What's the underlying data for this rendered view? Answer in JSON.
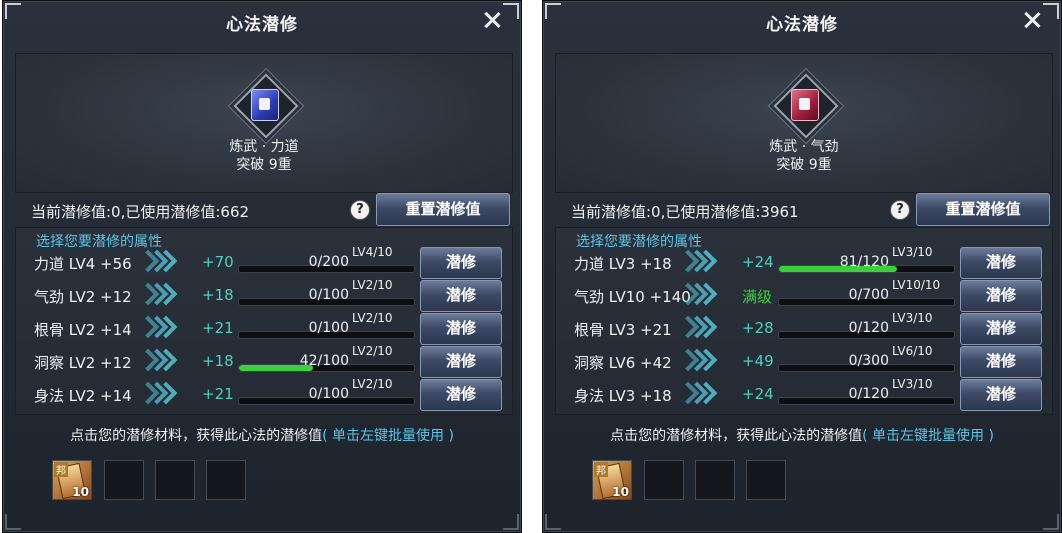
{
  "panels": [
    {
      "title": "心法潜修",
      "book_name": "炼武 · 力道",
      "book_break": "突破 9重",
      "status": "当前潜修值:0,已使用潜修值:662",
      "help_glyph": "?",
      "reset_label": "重置潜修值",
      "list_label": "选择您要潜修的属性",
      "rows": [
        {
          "attr": "力道 LV4 +56",
          "bonus": "+70",
          "progress": "0/200",
          "fill": 0.0,
          "lv": "LV4/10",
          "button": "潜修"
        },
        {
          "attr": "气劲 LV2 +12",
          "bonus": "+18",
          "progress": "0/100",
          "fill": 0.0,
          "lv": "LV2/10",
          "button": "潜修"
        },
        {
          "attr": "根骨 LV2 +14",
          "bonus": "+21",
          "progress": "0/100",
          "fill": 0.0,
          "lv": "LV2/10",
          "button": "潜修"
        },
        {
          "attr": "洞察 LV2 +12",
          "bonus": "+18",
          "progress": "42/100",
          "fill": 0.42,
          "lv": "LV2/10",
          "button": "潜修"
        },
        {
          "attr": "身法 LV2 +14",
          "bonus": "+21",
          "progress": "0/100",
          "fill": 0.0,
          "lv": "LV2/10",
          "button": "潜修"
        }
      ],
      "hint_text": "点击您的潜修材料，获得此心法的潜修值",
      "hint_link": "( 单击左键批量使用 )",
      "item_tag": "邦",
      "item_count": "10"
    },
    {
      "title": "心法潜修",
      "book_name": "炼武 · 气劲",
      "book_break": "突破 9重",
      "status": "当前潜修值:0,已使用潜修值:3961",
      "help_glyph": "?",
      "reset_label": "重置潜修值",
      "list_label": "选择您要潜修的属性",
      "rows": [
        {
          "attr": "力道 LV3 +18",
          "bonus": "+24",
          "progress": "81/120",
          "fill": 0.675,
          "lv": "LV3/10",
          "button": "潜修"
        },
        {
          "attr": "气劲 LV10 +140",
          "bonus": "满级",
          "progress": "0/700",
          "fill": 0.0,
          "lv": "LV10/10",
          "button": "潜修"
        },
        {
          "attr": "根骨 LV3 +21",
          "bonus": "+28",
          "progress": "0/120",
          "fill": 0.0,
          "lv": "LV3/10",
          "button": "潜修"
        },
        {
          "attr": "洞察 LV6 +42",
          "bonus": "+49",
          "progress": "0/300",
          "fill": 0.0,
          "lv": "LV6/10",
          "button": "潜修"
        },
        {
          "attr": "身法 LV3 +18",
          "bonus": "+24",
          "progress": "0/120",
          "fill": 0.0,
          "lv": "LV3/10",
          "button": "潜修"
        }
      ],
      "hint_text": "点击您的潜修材料，获得此心法的潜修值",
      "hint_link": "( 单击左键批量使用 )",
      "item_tag": "邦",
      "item_count": "10"
    }
  ],
  "colors": {
    "accent_cyan": "#5fc3e4",
    "progress_green": "#3ccf3c",
    "bonus_teal": "#4fcfc0"
  },
  "icons": {
    "book_left": "blue-manual-icon",
    "book_right": "red-manual-icon",
    "close": "close-icon",
    "help": "help-icon",
    "chevron": "triple-chevron-icon",
    "material": "scroll-item-icon"
  }
}
